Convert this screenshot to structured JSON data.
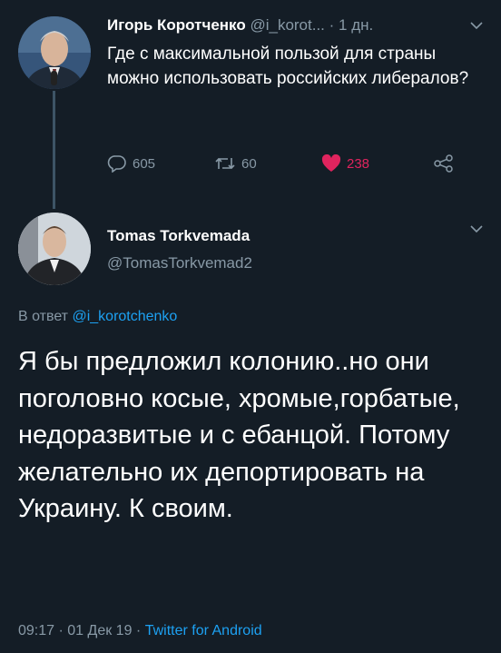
{
  "tweet1": {
    "name": "Игорь Коротченко",
    "handle": "@i_korot...",
    "separator": "·",
    "time": "1 дн.",
    "text": "Где с максимальной пользой для страны можно использовать российских либералов?",
    "replies": "605",
    "retweets": "60",
    "likes": "238"
  },
  "tweet2": {
    "name": "Tomas Torkvemada",
    "handle": "@TomasTorkvemad2",
    "reply_prefix": "В ответ",
    "reply_mention": "@i_korotchenko",
    "text": "Я бы предложил колонию..но они поголовно косые, хромые,горбатые, недоразвитые и с ебанцой. Потому желательно их депортировать на Украину. К своим.",
    "timestamp": "09:17 · 01 Дек 19 · ",
    "source": "Twitter for Android"
  },
  "colors": {
    "background": "#141d26",
    "secondary_text": "#8899a6",
    "link": "#1da1f2",
    "like": "#e0245e"
  },
  "icons": [
    "reply-icon",
    "retweet-icon",
    "heart-icon",
    "share-icon",
    "chevron-down-icon"
  ]
}
